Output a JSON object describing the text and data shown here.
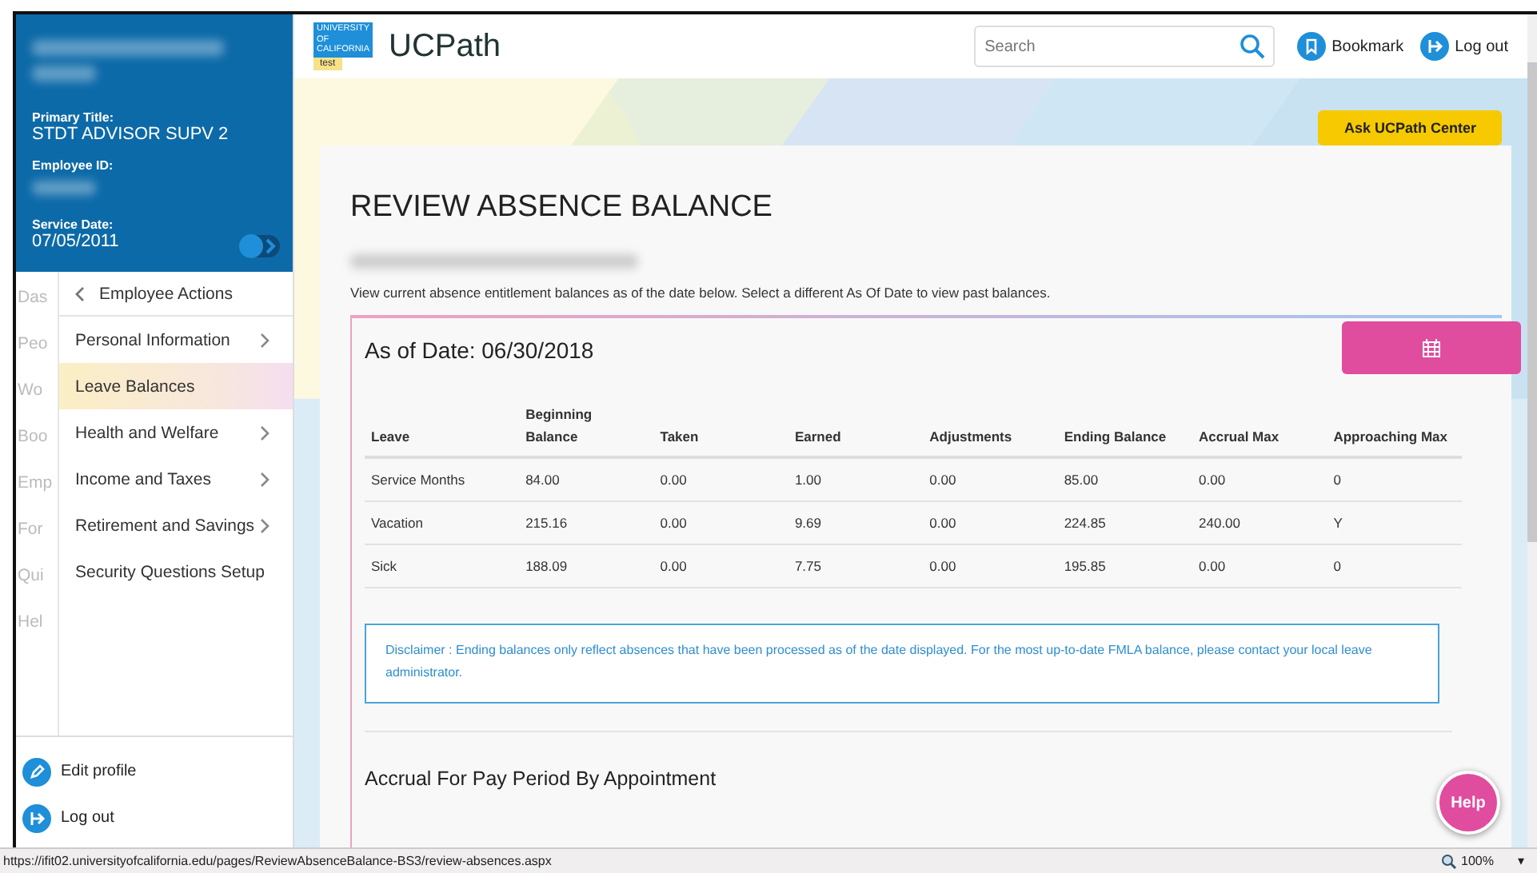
{
  "profile": {
    "primary_title_label": "Primary Title:",
    "primary_title": "STDT ADVISOR SUPV 2",
    "employee_id_label": "Employee ID:",
    "service_date_label": "Service Date:",
    "service_date": "07/05/2011"
  },
  "under_menu": [
    "Das",
    "Peo",
    "Wo",
    "Boo",
    "Emp",
    "For",
    "Qui",
    "Hel"
  ],
  "submenu": {
    "back_label": "Employee Actions",
    "items": [
      {
        "label": "Personal Information",
        "has_children": true,
        "selected": false
      },
      {
        "label": "Leave Balances",
        "has_children": false,
        "selected": true
      },
      {
        "label": "Health and Welfare",
        "has_children": true,
        "selected": false
      },
      {
        "label": "Income and Taxes",
        "has_children": true,
        "selected": false
      },
      {
        "label": "Retirement and Savings",
        "has_children": true,
        "selected": false
      },
      {
        "label": "Security Questions Setup",
        "has_children": false,
        "selected": false
      }
    ]
  },
  "sidebar_footer": [
    {
      "kind": "edit",
      "label": "Edit profile"
    },
    {
      "kind": "logout",
      "label": "Log out"
    }
  ],
  "header": {
    "logo_lines": [
      "UNIVERSITY",
      "OF",
      "CALIFORNIA"
    ],
    "env_badge": "test",
    "app_name": "UCPath",
    "search": {
      "placeholder": "Search"
    },
    "bookmark": "Bookmark",
    "logout": "Log out"
  },
  "ask_button": "Ask UCPath Center",
  "page_title": "REVIEW ABSENCE BALANCE",
  "description": "View current absence entitlement balances as of the date below. Select a different As Of Date to view past balances.",
  "as_of_date": "As of Date: 06/30/2018",
  "table": {
    "columns": [
      "Leave",
      "Beginning Balance",
      "Taken",
      "Earned",
      "Adjustments",
      "Ending Balance",
      "Accrual Max",
      "Approaching Max"
    ],
    "rows": [
      [
        "Service Months",
        "84.00",
        "0.00",
        "1.00",
        "0.00",
        "85.00",
        "0.00",
        "0"
      ],
      [
        "Vacation",
        "215.16",
        "0.00",
        "9.69",
        "0.00",
        "224.85",
        "240.00",
        "Y"
      ],
      [
        "Sick",
        "188.09",
        "0.00",
        "7.75",
        "0.00",
        "195.85",
        "0.00",
        "0"
      ]
    ]
  },
  "disclaimer": "Disclaimer : Ending balances only reflect absences that have been processed as of the date displayed. For the most up-to-date FMLA balance, please contact your local leave administrator.",
  "section_title": "Accrual For Pay Period By Appointment",
  "help_button": "Help",
  "status_bar": {
    "url": "https://ifit02.universityofcalifornia.edu/pages/ReviewAbsenceBalance-BS3/review-absences.aspx",
    "zoom": "100%",
    "zoom_caret": "▾"
  }
}
